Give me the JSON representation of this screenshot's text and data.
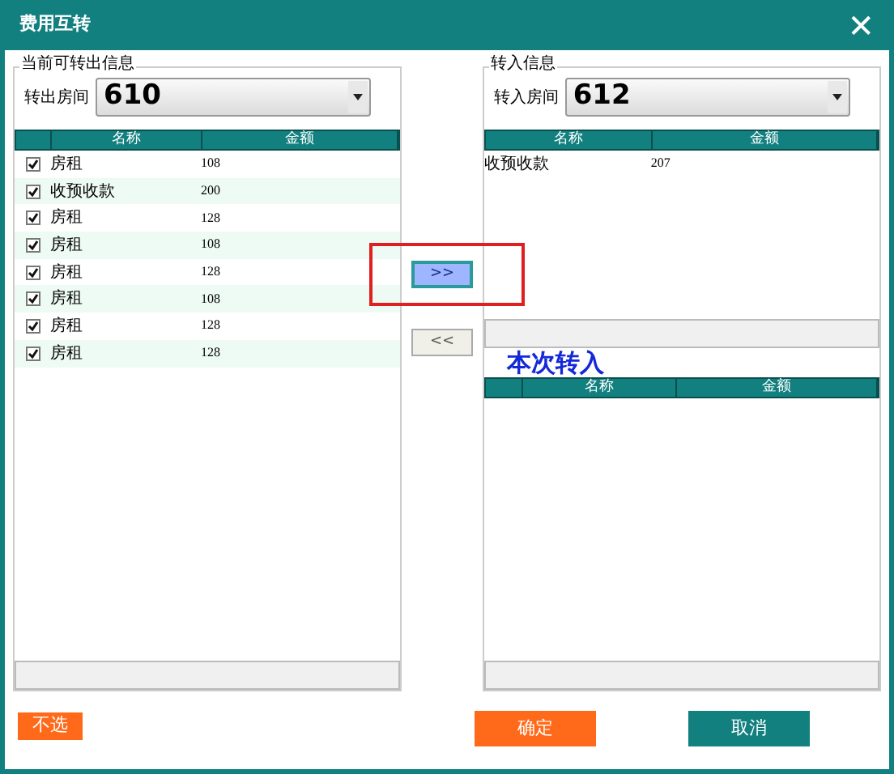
{
  "window": {
    "title": "费用互转",
    "close": "✕"
  },
  "source": {
    "legend": "当前可转出信息",
    "room_label": "转出房间",
    "room": "610",
    "columns": [
      "名称",
      "金额"
    ],
    "rows": [
      {
        "checked": true,
        "name": "房租",
        "amount": "108"
      },
      {
        "checked": true,
        "name": "收预收款",
        "amount": "200"
      },
      {
        "checked": true,
        "name": "房租",
        "amount": "128"
      },
      {
        "checked": true,
        "name": "房租",
        "amount": "108"
      },
      {
        "checked": true,
        "name": "房租",
        "amount": "128"
      },
      {
        "checked": true,
        "name": "房租",
        "amount": "108"
      },
      {
        "checked": true,
        "name": "房租",
        "amount": "128"
      },
      {
        "checked": true,
        "name": "房租",
        "amount": "128"
      }
    ]
  },
  "move_buttons": [
    {
      "label": ">>",
      "highlighted": true
    },
    {
      "label": "<<",
      "highlighted": false
    }
  ],
  "target": {
    "legend": "转入信息",
    "room_label": "转入房间",
    "room": "612",
    "columns": [
      "名称",
      "金额"
    ],
    "rows": [
      {
        "name": "收预收款",
        "amount": "207"
      }
    ]
  },
  "this_transfer": {
    "title": "本次转入",
    "columns": [
      "名称",
      "金额"
    ]
  },
  "buttons": [
    {
      "label": "不选",
      "kind": "small"
    },
    {
      "label": "确定",
      "kind": "confirm"
    },
    {
      "label": "取消",
      "kind": "cancel"
    }
  ]
}
